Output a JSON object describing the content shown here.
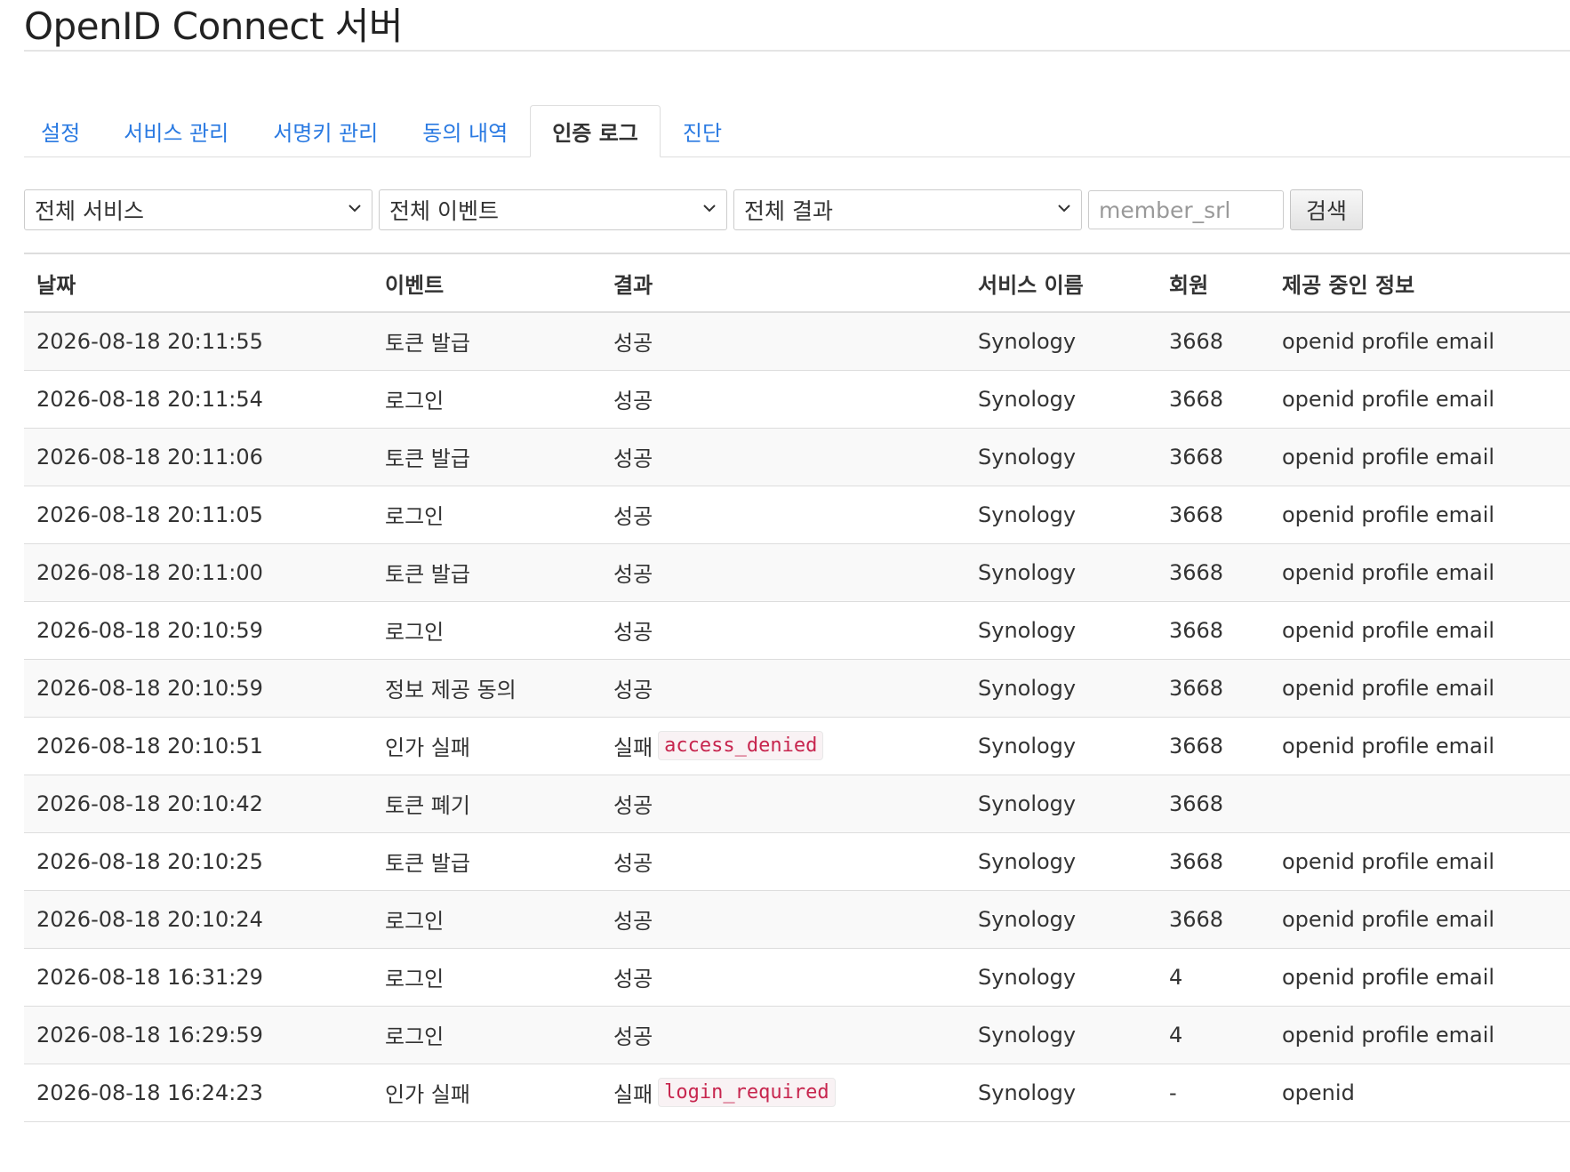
{
  "page": {
    "title": "OpenID Connect 서버"
  },
  "tabs": [
    {
      "label": "설정",
      "active": false
    },
    {
      "label": "서비스 관리",
      "active": false
    },
    {
      "label": "서명키 관리",
      "active": false
    },
    {
      "label": "동의 내역",
      "active": false
    },
    {
      "label": "인증 로그",
      "active": true
    },
    {
      "label": "진단",
      "active": false
    }
  ],
  "filters": {
    "service": {
      "selected": "전체 서비스"
    },
    "event": {
      "selected": "전체 이벤트"
    },
    "result": {
      "selected": "전체 결과"
    },
    "member_input": {
      "placeholder": "member_srl",
      "value": ""
    },
    "search_label": "검색"
  },
  "table": {
    "headers": {
      "date": "날짜",
      "event": "이벤트",
      "result": "결과",
      "service": "서비스 이름",
      "member": "회원",
      "scope": "제공 중인 정보"
    },
    "rows": [
      {
        "date": "2026-08-18 20:11:55",
        "event": "토큰 발급",
        "result": "성공",
        "error": "",
        "service": "Synology",
        "member": "3668",
        "scope": "openid profile email"
      },
      {
        "date": "2026-08-18 20:11:54",
        "event": "로그인",
        "result": "성공",
        "error": "",
        "service": "Synology",
        "member": "3668",
        "scope": "openid profile email"
      },
      {
        "date": "2026-08-18 20:11:06",
        "event": "토큰 발급",
        "result": "성공",
        "error": "",
        "service": "Synology",
        "member": "3668",
        "scope": "openid profile email"
      },
      {
        "date": "2026-08-18 20:11:05",
        "event": "로그인",
        "result": "성공",
        "error": "",
        "service": "Synology",
        "member": "3668",
        "scope": "openid profile email"
      },
      {
        "date": "2026-08-18 20:11:00",
        "event": "토큰 발급",
        "result": "성공",
        "error": "",
        "service": "Synology",
        "member": "3668",
        "scope": "openid profile email"
      },
      {
        "date": "2026-08-18 20:10:59",
        "event": "로그인",
        "result": "성공",
        "error": "",
        "service": "Synology",
        "member": "3668",
        "scope": "openid profile email"
      },
      {
        "date": "2026-08-18 20:10:59",
        "event": "정보 제공 동의",
        "result": "성공",
        "error": "",
        "service": "Synology",
        "member": "3668",
        "scope": "openid profile email"
      },
      {
        "date": "2026-08-18 20:10:51",
        "event": "인가 실패",
        "result": "실패",
        "error": "access_denied",
        "service": "Synology",
        "member": "3668",
        "scope": "openid profile email"
      },
      {
        "date": "2026-08-18 20:10:42",
        "event": "토큰 폐기",
        "result": "성공",
        "error": "",
        "service": "Synology",
        "member": "3668",
        "scope": ""
      },
      {
        "date": "2026-08-18 20:10:25",
        "event": "토큰 발급",
        "result": "성공",
        "error": "",
        "service": "Synology",
        "member": "3668",
        "scope": "openid profile email"
      },
      {
        "date": "2026-08-18 20:10:24",
        "event": "로그인",
        "result": "성공",
        "error": "",
        "service": "Synology",
        "member": "3668",
        "scope": "openid profile email"
      },
      {
        "date": "2026-08-18 16:31:29",
        "event": "로그인",
        "result": "성공",
        "error": "",
        "service": "Synology",
        "member": "4",
        "scope": "openid profile email"
      },
      {
        "date": "2026-08-18 16:29:59",
        "event": "로그인",
        "result": "성공",
        "error": "",
        "service": "Synology",
        "member": "4",
        "scope": "openid profile email"
      },
      {
        "date": "2026-08-18 16:24:23",
        "event": "인가 실패",
        "result": "실패",
        "error": "login_required",
        "service": "Synology",
        "member": "-",
        "scope": "openid"
      }
    ]
  },
  "icons": {
    "select_chevron": "chevron-down-icon"
  }
}
